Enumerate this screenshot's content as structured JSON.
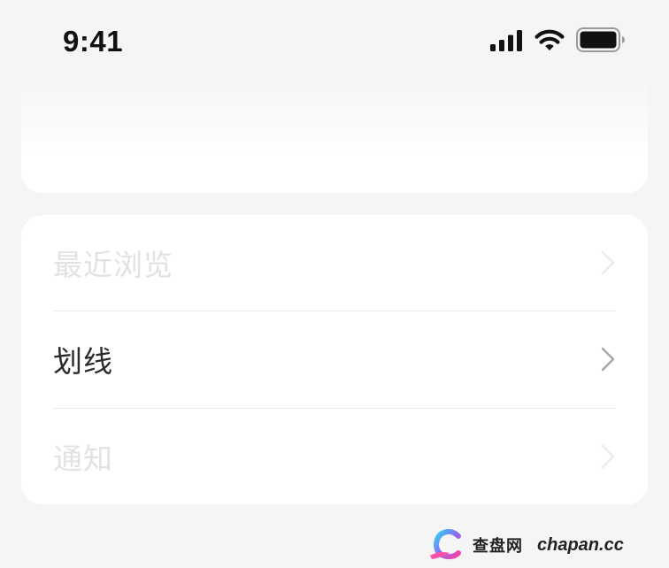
{
  "status_bar": {
    "time": "9:41",
    "icons": [
      "cellular-signal-icon",
      "wifi-icon",
      "battery-icon"
    ]
  },
  "menu": {
    "items": [
      {
        "label": "最近浏览",
        "state": "dimmed",
        "icon": "chevron-right-icon"
      },
      {
        "label": "划线",
        "state": "active",
        "icon": "chevron-right-icon"
      },
      {
        "label": "通知",
        "state": "dimmed",
        "icon": "chevron-right-icon"
      }
    ]
  },
  "watermark": {
    "cn_text": "查盘网",
    "en_text": "chapan.cc"
  },
  "colors": {
    "background": "#f5f5f5",
    "card": "#ffffff",
    "text_active": "#2a2a2a",
    "text_dimmed": "#e2e2e2",
    "chevron_active": "#a8a8a8",
    "chevron_dimmed": "#ececec"
  }
}
